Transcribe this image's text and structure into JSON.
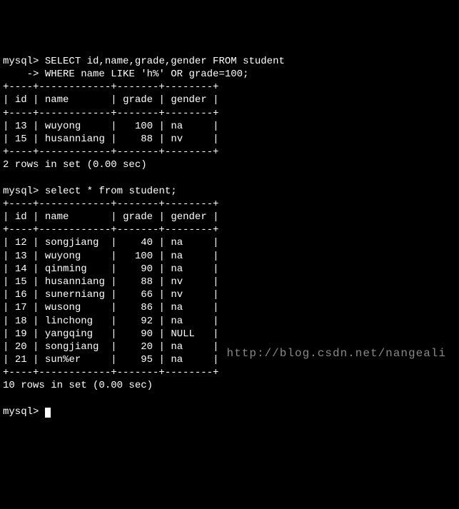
{
  "prompt": "mysql>",
  "continuation": "    ->",
  "query1_line1": " SELECT id,name,grade,gender FROM student",
  "query1_line2": " WHERE name LIKE 'h%' OR grade=100;",
  "query2": " select * from student;",
  "columns": [
    "id",
    "name",
    "grade",
    "gender"
  ],
  "table1_rows": [
    {
      "id": "13",
      "name": "wuyong",
      "grade": "100",
      "gender": "na"
    },
    {
      "id": "15",
      "name": "husanniang",
      "grade": "88",
      "gender": "nv"
    }
  ],
  "table1_summary": "2 rows in set (0.00 sec)",
  "table2_rows": [
    {
      "id": "12",
      "name": "songjiang",
      "grade": "40",
      "gender": "na"
    },
    {
      "id": "13",
      "name": "wuyong",
      "grade": "100",
      "gender": "na"
    },
    {
      "id": "14",
      "name": "qinming",
      "grade": "90",
      "gender": "na"
    },
    {
      "id": "15",
      "name": "husanniang",
      "grade": "88",
      "gender": "nv"
    },
    {
      "id": "16",
      "name": "sunerniang",
      "grade": "66",
      "gender": "nv"
    },
    {
      "id": "17",
      "name": "wusong",
      "grade": "86",
      "gender": "na"
    },
    {
      "id": "18",
      "name": "linchong",
      "grade": "92",
      "gender": "na"
    },
    {
      "id": "19",
      "name": "yangqing",
      "grade": "90",
      "gender": "NULL"
    },
    {
      "id": "20",
      "name": "songjiang",
      "grade": "20",
      "gender": "na"
    },
    {
      "id": "21",
      "name": "sun%er",
      "grade": "95",
      "gender": "na"
    }
  ],
  "table2_summary": "10 rows in set (0.00 sec)",
  "watermark": "http://blog.csdn.net/nangeali",
  "chart_data": {
    "type": "table",
    "title": "MySQL query results",
    "tables": [
      {
        "query": "SELECT id,name,grade,gender FROM student WHERE name LIKE 'h%' OR grade=100;",
        "columns": [
          "id",
          "name",
          "grade",
          "gender"
        ],
        "rows": [
          [
            13,
            "wuyong",
            100,
            "na"
          ],
          [
            15,
            "husanniang",
            88,
            "nv"
          ]
        ],
        "summary": "2 rows in set (0.00 sec)"
      },
      {
        "query": "select * from student;",
        "columns": [
          "id",
          "name",
          "grade",
          "gender"
        ],
        "rows": [
          [
            12,
            "songjiang",
            40,
            "na"
          ],
          [
            13,
            "wuyong",
            100,
            "na"
          ],
          [
            14,
            "qinming",
            90,
            "na"
          ],
          [
            15,
            "husanniang",
            88,
            "nv"
          ],
          [
            16,
            "sunerniang",
            66,
            "nv"
          ],
          [
            17,
            "wusong",
            86,
            "na"
          ],
          [
            18,
            "linchong",
            92,
            "na"
          ],
          [
            19,
            "yangqing",
            90,
            "NULL"
          ],
          [
            20,
            "songjiang",
            20,
            "na"
          ],
          [
            21,
            "sun%er",
            95,
            "na"
          ]
        ],
        "summary": "10 rows in set (0.00 sec)"
      }
    ]
  }
}
